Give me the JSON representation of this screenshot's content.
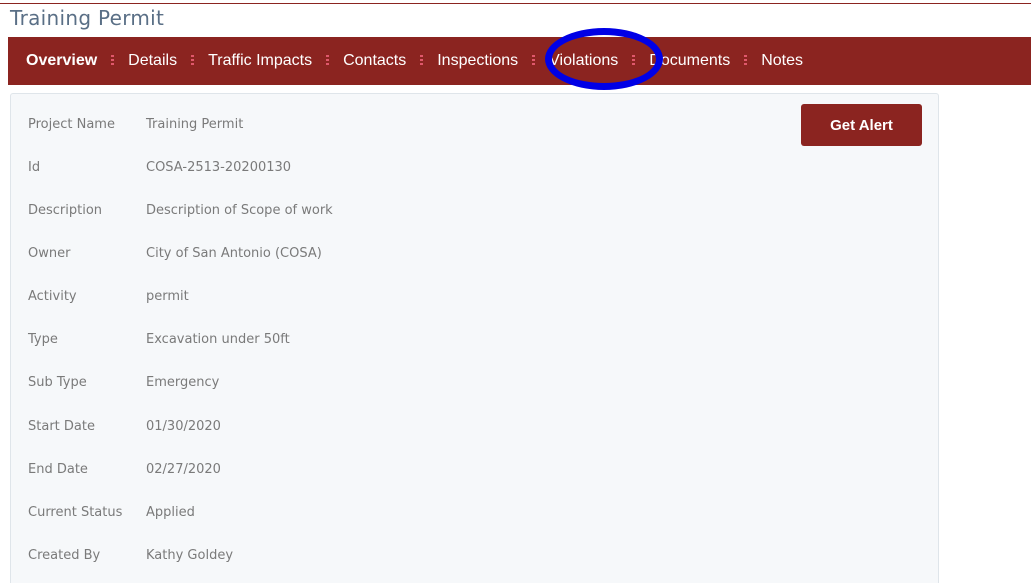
{
  "page": {
    "title": "Training Permit"
  },
  "tabs": [
    {
      "label": "Overview",
      "active": true
    },
    {
      "label": "Details"
    },
    {
      "label": "Traffic Impacts"
    },
    {
      "label": "Contacts"
    },
    {
      "label": "Inspections",
      "highlighted": true
    },
    {
      "label": "Violations"
    },
    {
      "label": "Documents"
    },
    {
      "label": "Notes"
    }
  ],
  "actions": {
    "get_alert": "Get Alert"
  },
  "fields": [
    {
      "label": "Project Name",
      "value": "Training Permit"
    },
    {
      "label": "Id",
      "value": "COSA-2513-20200130"
    },
    {
      "label": "Description",
      "value": "Description of Scope of work"
    },
    {
      "label": "Owner",
      "value": "City of San Antonio (COSA)"
    },
    {
      "label": "Activity",
      "value": "permit"
    },
    {
      "label": "Type",
      "value": "Excavation under 50ft"
    },
    {
      "label": "Sub Type",
      "value": "Emergency"
    },
    {
      "label": "Start Date",
      "value": "01/30/2020"
    },
    {
      "label": "End Date",
      "value": "02/27/2020"
    },
    {
      "label": "Current Status",
      "value": "Applied"
    },
    {
      "label": "Created By",
      "value": "Kathy Goldey"
    }
  ],
  "colors": {
    "brand": "#8b2420",
    "title": "#5a6f86",
    "highlight": "#0000e6",
    "separator": "#e0586b"
  }
}
